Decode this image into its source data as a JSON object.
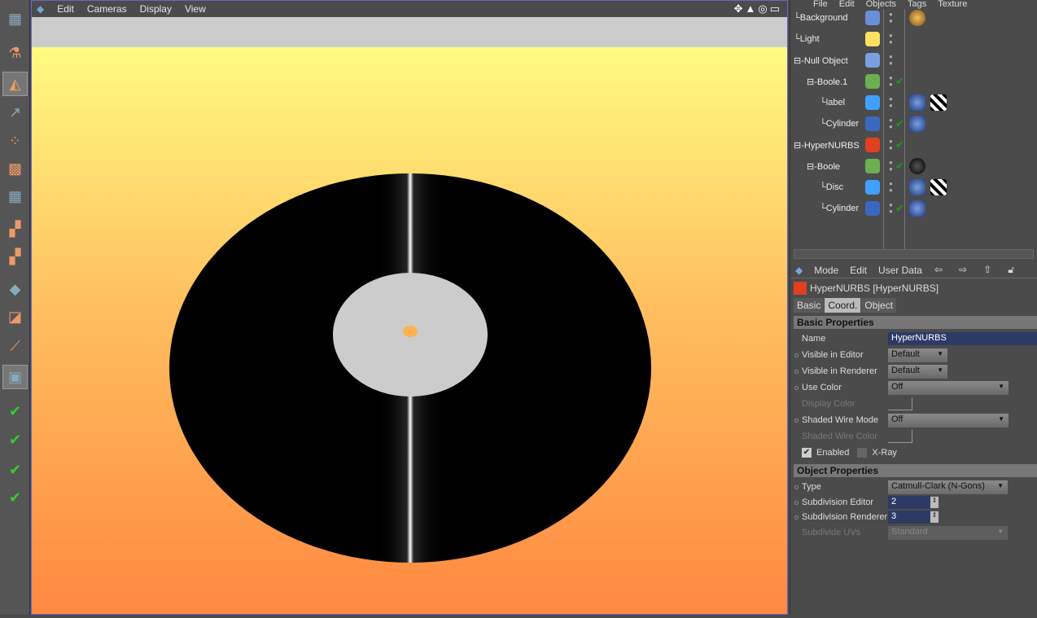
{
  "viewport": {
    "menu": [
      "Edit",
      "Cameras",
      "Display",
      "View"
    ],
    "nav_icons": [
      "move-icon",
      "zoom-icon",
      "rotate-icon",
      "maximize-icon"
    ]
  },
  "left_toolbar": {
    "tools": [
      "layout-icon",
      "undo-icon",
      "model-tool-icon",
      "object-axis-icon",
      "points-icon",
      "edges-icon",
      "polygons-icon",
      "texture-icon",
      "texture-axis-icon",
      "object-tool-icon",
      "animation-icon",
      "inverse-kinematics-icon",
      "render-region-icon",
      "render-view-icon",
      "render-picture-viewer-icon",
      "render-settings-icon",
      "edit-render-settings-icon"
    ]
  },
  "object_manager": {
    "menu": [
      "File",
      "Edit",
      "Objects",
      "Tags",
      "Texture"
    ],
    "objects": [
      {
        "name": "Background",
        "level": 0,
        "icon": "background-icon",
        "check": false,
        "tags": [
          "material-gold-icon"
        ]
      },
      {
        "name": "Light",
        "level": 0,
        "icon": "light-icon",
        "check": false,
        "tags": []
      },
      {
        "name": "Null Object",
        "level": 0,
        "icon": "null-object-icon",
        "check": false,
        "tags": []
      },
      {
        "name": "Boole.1",
        "level": 1,
        "icon": "boole-icon",
        "check": true,
        "tags": []
      },
      {
        "name": "label",
        "level": 2,
        "icon": "polygon-object-icon",
        "check": false,
        "tags": [
          "uvw-tag-icon",
          "texture-tag-icon"
        ]
      },
      {
        "name": "Cylinder",
        "level": 2,
        "icon": "cylinder-icon",
        "check": true,
        "tags": [
          "uvw-tag-icon"
        ]
      },
      {
        "name": "HyperNURBS",
        "level": 0,
        "icon": "hypernurbs-icon",
        "check": true,
        "tags": []
      },
      {
        "name": "Boole",
        "level": 1,
        "icon": "boole-icon",
        "check": true,
        "tags": [
          "material-black-icon"
        ]
      },
      {
        "name": "Disc",
        "level": 2,
        "icon": "polygon-object-icon",
        "check": false,
        "tags": [
          "uvw-tag-icon",
          "texture-tag-icon"
        ]
      },
      {
        "name": "Cylinder",
        "level": 2,
        "icon": "cylinder-icon",
        "check": true,
        "tags": [
          "uvw-tag-icon"
        ]
      }
    ]
  },
  "attributes": {
    "menu": [
      "Mode",
      "Edit",
      "User Data"
    ],
    "title": "HyperNURBS [HyperNURBS]",
    "tabs": [
      "Basic",
      "Coord.",
      "Object"
    ],
    "basic_header": "Basic Properties",
    "name_label": "Name",
    "name_value": "HyperNURBS",
    "vis_editor_label": "Visible in Editor",
    "vis_editor_value": "Default",
    "vis_render_label": "Visible in Renderer",
    "vis_render_value": "Default",
    "use_color_label": "Use Color",
    "use_color_value": "Off",
    "display_color_label": "Display Color",
    "wire_mode_label": "Shaded Wire Mode",
    "wire_mode_value": "Off",
    "wire_color_label": "Shaded Wire Color",
    "enabled_label": "Enabled",
    "enabled": true,
    "xray_label": "X-Ray",
    "xray": false,
    "object_header": "Object Properties",
    "type_label": "Type",
    "type_value": "Catmull-Clark (N-Gons)",
    "sub_editor_label": "Subdivision Editor",
    "sub_editor_value": "2",
    "sub_render_label": "Subdivision Renderer",
    "sub_render_value": "3",
    "sub_uv_label": "Subdivide UVs",
    "sub_uv_value": "Standard"
  },
  "colors": {
    "sky_top": "#fffb80",
    "sky_bottom": "#ff8840",
    "record": "#000000",
    "label": "#cccccc",
    "spindle": "#ffb050"
  }
}
